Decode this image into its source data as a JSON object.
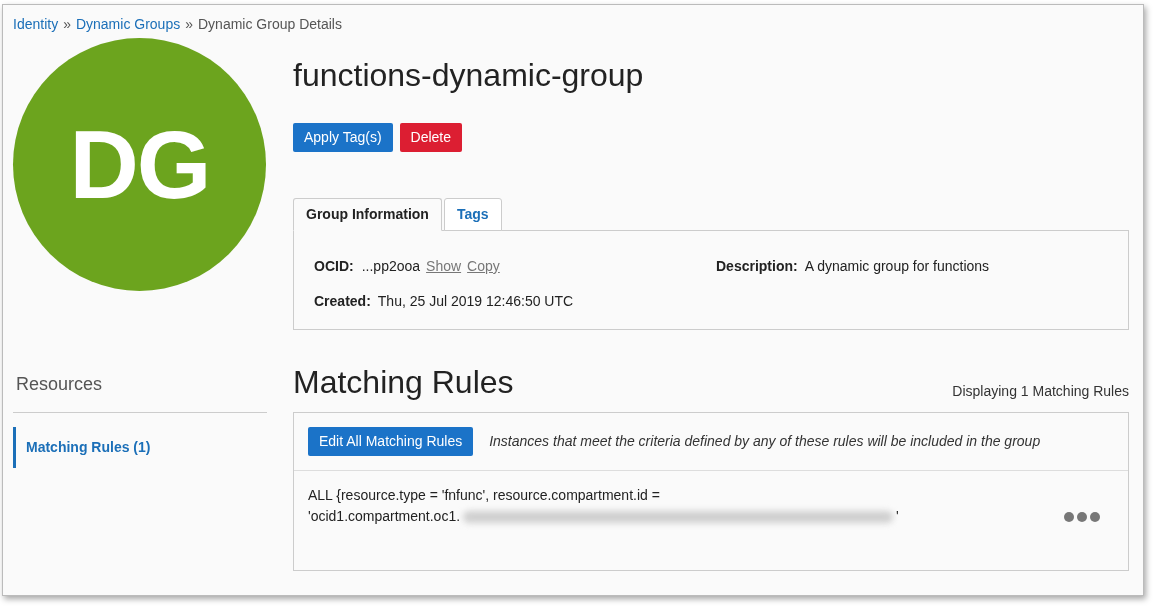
{
  "breadcrumb": [
    {
      "label": "Identity",
      "link": true
    },
    {
      "label": "Dynamic Groups",
      "link": true
    },
    {
      "label": "Dynamic Group Details",
      "link": false
    }
  ],
  "breadcrumb_separator": "»",
  "avatar": {
    "initials": "DG",
    "color": "#6ca41e"
  },
  "title": "functions-dynamic-group",
  "actions": [
    {
      "label": "Apply Tag(s)",
      "kind": "primary"
    },
    {
      "label": "Delete",
      "kind": "danger"
    }
  ],
  "tabs": [
    {
      "label": "Group Information",
      "selected": true
    },
    {
      "label": "Tags",
      "selected": false
    }
  ],
  "info": {
    "ocid_label": "OCID:",
    "ocid_value": "...pp2ooa",
    "ocid_links": [
      "Show",
      "Copy"
    ],
    "created_label": "Created:",
    "created_value": "Thu, 25 Jul 2019 12:46:50 UTC",
    "description_label": "Description:",
    "description_value": "A dynamic group for functions"
  },
  "sidebar": {
    "heading": "Resources",
    "items": [
      {
        "label": "Matching Rules (1)",
        "selected": true
      }
    ]
  },
  "rules_section": {
    "heading": "Matching Rules",
    "count_text": "Displaying 1 Matching Rules",
    "edit_button": "Edit All Matching Rules",
    "hint": "Instances that meet the criteria defined by any of these rules will be included in the group",
    "rules": [
      {
        "line_1": "ALL {resource.type = 'fnfunc', resource.compartment.id =",
        "line_2": "'ocid1.compartment.oc1.",
        "redacted": true,
        "trailing": "'"
      }
    ]
  }
}
